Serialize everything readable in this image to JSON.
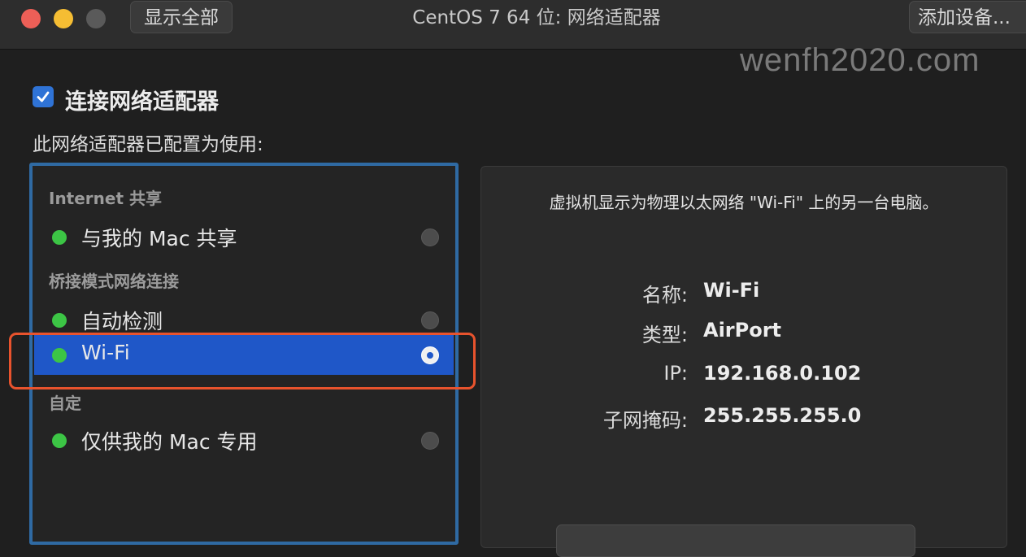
{
  "window": {
    "title": "CentOS 7 64 位: 网络适配器",
    "show_all_label": "显示全部",
    "add_device_label": "添加设备..."
  },
  "watermark": "wenfh2020.com",
  "connect_adapter": {
    "checked": true,
    "label": "连接网络适配器"
  },
  "configured_label": "此网络适配器已配置为使用:",
  "adapter_list": {
    "sections": [
      {
        "header": "Internet 共享",
        "items": [
          {
            "label": "与我的 Mac 共享",
            "status_color": "#3cc545",
            "selected": false
          }
        ]
      },
      {
        "header": "桥接模式网络连接",
        "items": [
          {
            "label": "自动检测",
            "status_color": "#3cc545",
            "selected": false
          },
          {
            "label": "Wi-Fi",
            "status_color": "#3cc545",
            "selected": true
          }
        ]
      },
      {
        "header": "自定",
        "items": [
          {
            "label": "仅供我的 Mac 专用",
            "status_color": "#3cc545",
            "selected": false
          }
        ]
      }
    ]
  },
  "detail": {
    "description": "虚拟机显示为物理以太网络 \"Wi-Fi\" 上的另一台电脑。",
    "name_label": "名称:",
    "name_value": "Wi-Fi",
    "type_label": "类型:",
    "type_value": "AirPort",
    "ip_label": "IP:",
    "ip_value": "192.168.0.102",
    "mask_label": "子网掩码:",
    "mask_value": "255.255.255.0"
  },
  "colors": {
    "accent": "#1f57c8",
    "highlight_annotation": "#e8532d",
    "list_border": "#2f6aa3",
    "status_green": "#3cc545"
  }
}
